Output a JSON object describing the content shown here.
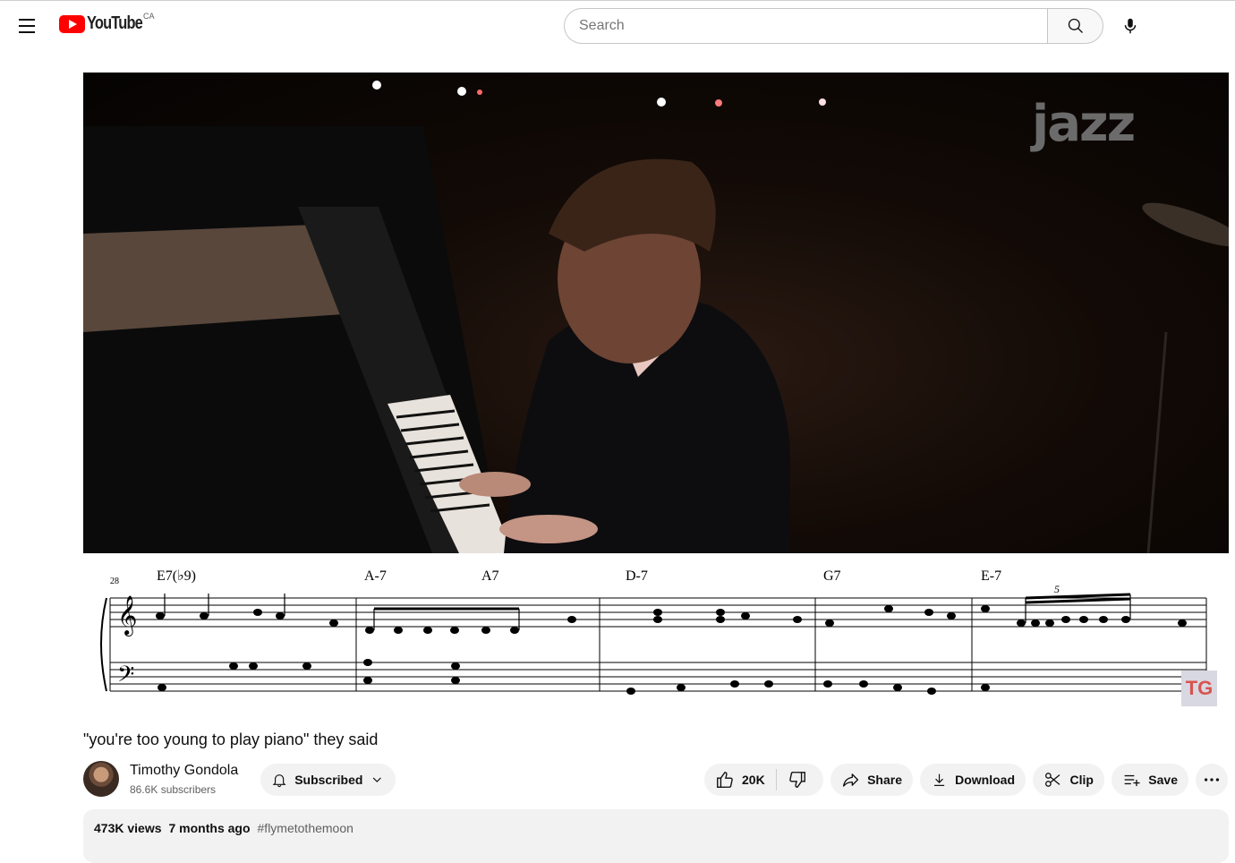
{
  "masthead": {
    "logo_text": "YouTube",
    "country_code": "CA",
    "search_placeholder": "Search"
  },
  "video": {
    "overlay_logo": "jazz",
    "watermark": "TG",
    "sheet_music": {
      "measure_number": "28",
      "chords": [
        "E7(♭9)",
        "A-7",
        "A7",
        "D-7",
        "G7",
        "E-7"
      ],
      "tuplet": "5"
    }
  },
  "title": "\"you're too young to play piano\" they said",
  "channel": {
    "name": "Timothy Gondola",
    "subscribers": "86.6K subscribers",
    "subscribe_label": "Subscribed"
  },
  "actions": {
    "like_count": "20K",
    "share": "Share",
    "download": "Download",
    "clip": "Clip",
    "save": "Save"
  },
  "description": {
    "views": "473K views",
    "time": "7 months ago",
    "hashtag": "#flymetothemoon"
  },
  "icons": [
    "menu-icon",
    "search-icon",
    "mic-icon",
    "bell-icon",
    "chevron-down-icon",
    "thumbs-up-icon",
    "thumbs-down-icon",
    "share-icon",
    "download-icon",
    "scissors-icon",
    "playlist-add-icon",
    "more-icon"
  ]
}
